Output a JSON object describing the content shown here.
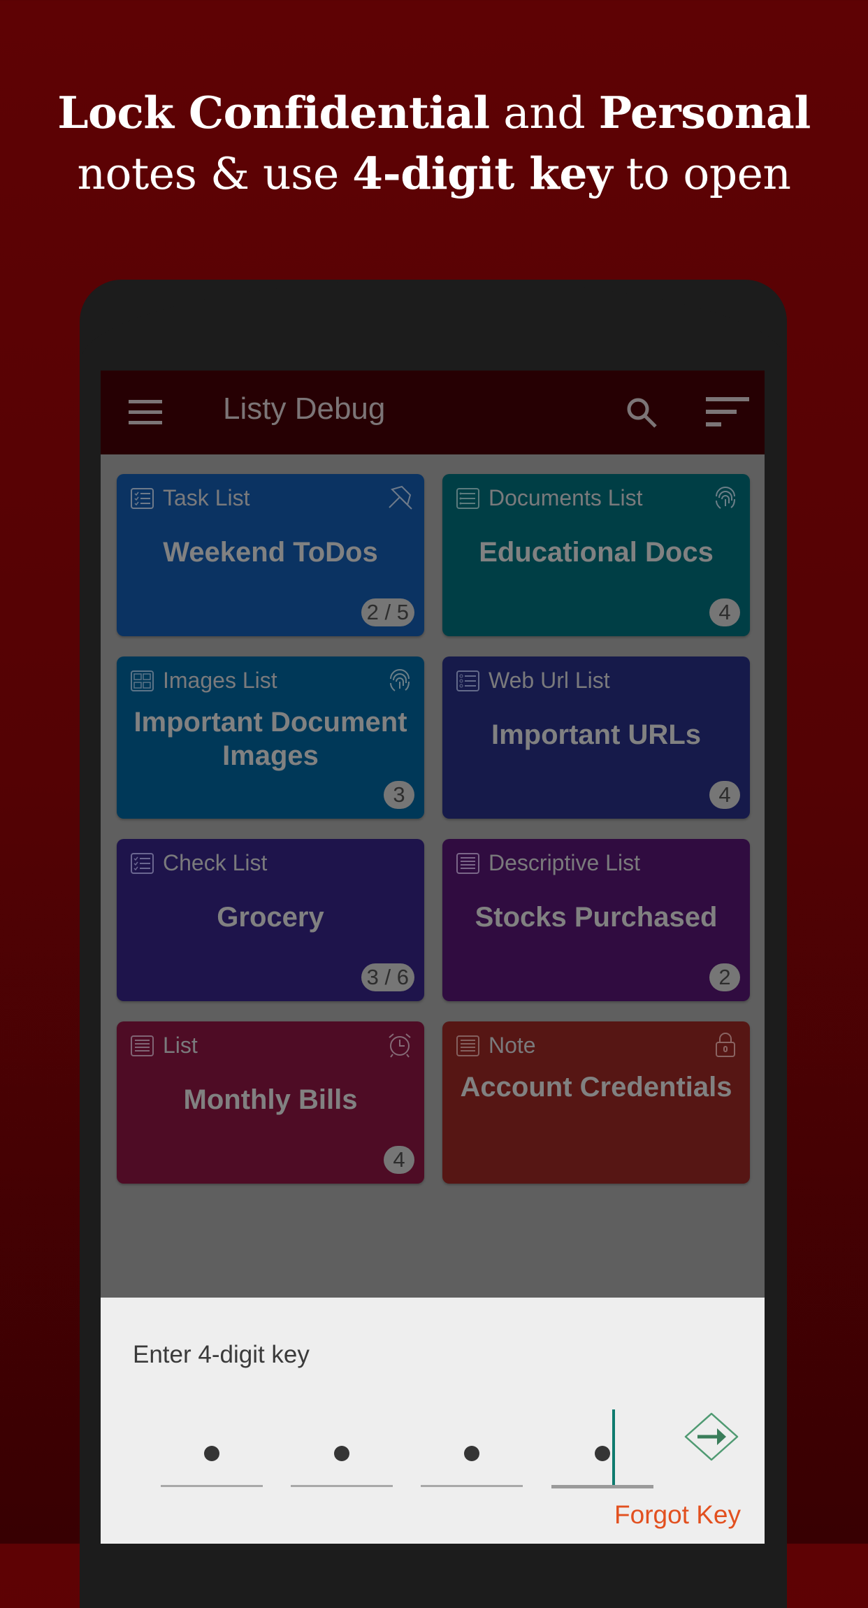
{
  "headline": {
    "line1": [
      {
        "text": "Lock Confidential",
        "bold": true
      },
      {
        "text": " and ",
        "bold": false
      },
      {
        "text": "Personal",
        "bold": true
      }
    ],
    "line2": [
      {
        "text": "notes & use ",
        "bold": false
      },
      {
        "text": "4-digit key",
        "bold": true
      },
      {
        "text": " to open",
        "bold": false
      }
    ]
  },
  "appbar": {
    "title": "Listy Debug",
    "menu_icon": "hamburger-menu-icon",
    "search_icon": "search-icon",
    "sort_icon": "sort-icon"
  },
  "cards": [
    {
      "type": "Task List",
      "type_icon": "task-list-icon",
      "name": "Weekend ToDos",
      "badge": "2 / 5",
      "corner_icon": "pin-icon",
      "color": "#0b3362"
    },
    {
      "type": "Documents List",
      "type_icon": "documents-list-icon",
      "name": "Educational Docs",
      "badge": "4",
      "corner_icon": "fingerprint-icon",
      "color": "#003e45"
    },
    {
      "type": "Images List",
      "type_icon": "images-list-icon",
      "name": "Important Document Images",
      "badge": "3",
      "corner_icon": "fingerprint-icon",
      "color": "#003858"
    },
    {
      "type": "Web Url List",
      "type_icon": "web-url-list-icon",
      "name": "Important URLs",
      "badge": "4",
      "corner_icon": "",
      "color": "#161a4a"
    },
    {
      "type": "Check List",
      "type_icon": "check-list-icon",
      "name": "Grocery",
      "badge": "3 / 6",
      "corner_icon": "",
      "color": "#1e144b"
    },
    {
      "type": "Descriptive List",
      "type_icon": "descriptive-list-icon",
      "name": "Stocks Purchased",
      "badge": "2",
      "corner_icon": "",
      "color": "#300c40"
    },
    {
      "type": "List",
      "type_icon": "list-icon",
      "name": "Monthly Bills",
      "badge": "4",
      "corner_icon": "alarm-clock-icon",
      "color": "#4e0c25"
    },
    {
      "type": "Note",
      "type_icon": "note-icon",
      "name": "Account Credentials",
      "badge": "",
      "corner_icon": "lock-icon",
      "color": "#561614"
    }
  ],
  "key_sheet": {
    "prompt": "Enter 4-digit key",
    "digits_filled": 4,
    "digits_total": 4,
    "digit_mask": "•",
    "submit_icon": "arrow-right-diamond-icon",
    "forgot_label": "Forgot Key",
    "accent_color": "#0f7b6f",
    "submit_color": "#3a7d5a",
    "forgot_color": "#e2501f"
  }
}
